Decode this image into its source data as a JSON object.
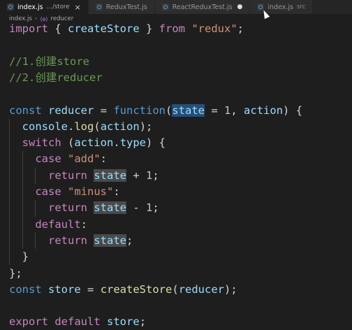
{
  "tabs": [
    {
      "name": "tab-index-store",
      "icon": "javascript-file-icon",
      "label": "index.js",
      "desc": "…/store",
      "state": "close",
      "active": true
    },
    {
      "name": "tab-reduxtest",
      "icon": "javascript-file-icon",
      "label": "ReduxTest.js",
      "desc": "",
      "state": "",
      "active": false
    },
    {
      "name": "tab-reactreduxtest",
      "icon": "javascript-file-icon",
      "label": "ReactReduxTest.js",
      "desc": "",
      "state": "dirty",
      "active": false
    },
    {
      "name": "tab-index-src",
      "icon": "javascript-file-icon",
      "label": "index.js",
      "desc": "src",
      "state": "",
      "active": false
    }
  ],
  "tab_glyphs": {
    "close": "×",
    "dirty": "●"
  },
  "breadcrumb": {
    "file": "index.js",
    "separator": "›",
    "symbol_icon_text": "⟨e⟩",
    "symbol": "reducer"
  },
  "code_lines": [
    [
      [
        "import",
        "tok-ctrl"
      ],
      [
        " { ",
        "tok-punc"
      ],
      [
        "createStore",
        "tok-var"
      ],
      [
        " } ",
        "tok-punc"
      ],
      [
        "from",
        "tok-ctrl"
      ],
      [
        " ",
        ""
      ],
      [
        "\"redux\"",
        "tok-str"
      ],
      [
        ";",
        "tok-punc"
      ]
    ],
    [],
    [
      [
        "//1.创建store",
        "tok-comment"
      ]
    ],
    [
      [
        "//2.创建reducer",
        "tok-comment"
      ]
    ],
    [],
    [
      [
        "const",
        "tok-kw"
      ],
      [
        " ",
        ""
      ],
      [
        "reducer",
        "tok-var"
      ],
      [
        " = ",
        "tok-punc"
      ],
      [
        "function",
        "tok-kw"
      ],
      [
        "(",
        "tok-punc"
      ],
      [
        "state",
        "tok-var hl-sel"
      ],
      [
        " = ",
        "tok-punc"
      ],
      [
        "1",
        "tok-num"
      ],
      [
        ", ",
        "tok-punc"
      ],
      [
        "action",
        "tok-var"
      ],
      [
        ") {",
        "tok-punc"
      ]
    ],
    [
      [
        "  ",
        ""
      ],
      [
        "console",
        "tok-var"
      ],
      [
        ".",
        "tok-punc"
      ],
      [
        "log",
        "tok-fn"
      ],
      [
        "(",
        "tok-punc"
      ],
      [
        "action",
        "tok-var"
      ],
      [
        ");",
        "tok-punc"
      ]
    ],
    [
      [
        "  ",
        ""
      ],
      [
        "switch",
        "tok-ctrl"
      ],
      [
        " (",
        "tok-punc"
      ],
      [
        "action",
        "tok-var"
      ],
      [
        ".",
        "tok-punc"
      ],
      [
        "type",
        "tok-var"
      ],
      [
        ") {",
        "tok-punc"
      ]
    ],
    [
      [
        "    ",
        ""
      ],
      [
        "case",
        "tok-ctrl"
      ],
      [
        " ",
        ""
      ],
      [
        "\"add\"",
        "tok-str"
      ],
      [
        ":",
        "tok-punc"
      ]
    ],
    [
      [
        "      ",
        ""
      ],
      [
        "return",
        "tok-ctrl"
      ],
      [
        " ",
        ""
      ],
      [
        "state",
        "tok-var hl-ref"
      ],
      [
        " + ",
        "tok-punc"
      ],
      [
        "1",
        "tok-num"
      ],
      [
        ";",
        "tok-punc"
      ]
    ],
    [
      [
        "    ",
        ""
      ],
      [
        "case",
        "tok-ctrl"
      ],
      [
        " ",
        ""
      ],
      [
        "\"minus\"",
        "tok-str"
      ],
      [
        ":",
        "tok-punc"
      ]
    ],
    [
      [
        "      ",
        ""
      ],
      [
        "return",
        "tok-ctrl"
      ],
      [
        " ",
        ""
      ],
      [
        "state",
        "tok-var hl-ref"
      ],
      [
        " - ",
        "tok-punc"
      ],
      [
        "1",
        "tok-num"
      ],
      [
        ";",
        "tok-punc"
      ]
    ],
    [
      [
        "    ",
        ""
      ],
      [
        "default",
        "tok-ctrl"
      ],
      [
        ":",
        "tok-punc"
      ]
    ],
    [
      [
        "      ",
        ""
      ],
      [
        "return",
        "tok-ctrl"
      ],
      [
        " ",
        ""
      ],
      [
        "state",
        "tok-var hl-ref"
      ],
      [
        ";",
        "tok-punc"
      ]
    ],
    [
      [
        "  ",
        ""
      ],
      [
        "}",
        "tok-punc"
      ]
    ],
    [
      [
        "};",
        "tok-punc"
      ]
    ],
    [
      [
        "const",
        "tok-kw"
      ],
      [
        " ",
        ""
      ],
      [
        "store",
        "tok-var"
      ],
      [
        " = ",
        "tok-punc"
      ],
      [
        "createStore",
        "tok-fn"
      ],
      [
        "(",
        "tok-punc"
      ],
      [
        "reducer",
        "tok-var"
      ],
      [
        ");",
        "tok-punc"
      ]
    ],
    [],
    [
      [
        "export",
        "tok-ctrl"
      ],
      [
        " ",
        ""
      ],
      [
        "default",
        "tok-ctrl"
      ],
      [
        " ",
        ""
      ],
      [
        "store",
        "tok-var"
      ],
      [
        ";",
        "tok-punc"
      ]
    ]
  ],
  "colors": {
    "editor_bg": "#1e1e1e",
    "tabbar_bg": "#252526",
    "keyword": "#569cd6",
    "control": "#c586c0",
    "string": "#ce9178",
    "number": "#b5cea8",
    "variable": "#9cdcfe",
    "function": "#dcdcaa",
    "comment": "#6a9955",
    "selection": "#264f78",
    "reference_highlight": "#4a4a4a"
  }
}
